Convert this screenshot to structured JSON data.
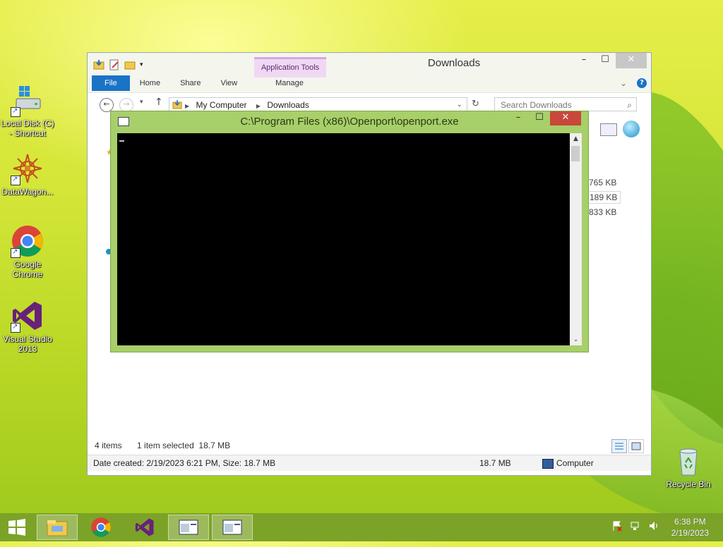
{
  "desktop": {
    "icons": [
      {
        "label": "Local Disk (C) - Shortcut"
      },
      {
        "label": "DataWagon..."
      },
      {
        "label": "Google Chrome"
      },
      {
        "label": "Visual Studio 2013"
      },
      {
        "label": "Recycle Bin"
      }
    ]
  },
  "explorer": {
    "title": "Downloads",
    "contextual_tab": "Application Tools",
    "ribbon_tabs": {
      "file": "File",
      "home": "Home",
      "share": "Share",
      "view": "View",
      "manage": "Manage"
    },
    "breadcrumb": [
      "My Computer",
      "Downloads"
    ],
    "search_placeholder": "Search Downloads",
    "visible_sizes": [
      "0,765 KB",
      "9,189 KB",
      "2,833 KB"
    ],
    "item_count": "4 items",
    "selection": "1 item selected  18.7 MB",
    "details": {
      "info": "Date created: 2/19/2023 6:21 PM, Size: 18.7 MB",
      "size": "18.7 MB",
      "location": "Computer"
    }
  },
  "console": {
    "title": "C:\\Program Files (x86)\\Openport\\openport.exe"
  },
  "taskbar": {
    "clock_time": "6:38 PM",
    "clock_date": "2/19/2023"
  },
  "colors": {
    "accent": "#1a73c6",
    "console_frame": "#a7cf6a",
    "close_red": "#c8483a",
    "contextual_tab": "#f0d8f4"
  }
}
